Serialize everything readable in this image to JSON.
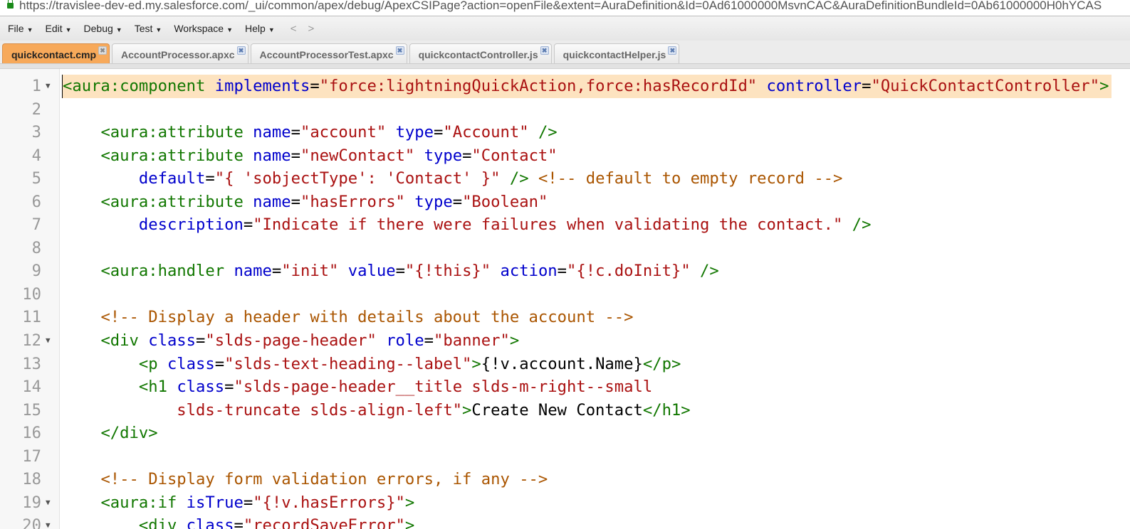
{
  "browser": {
    "url": "https://travislee-dev-ed.my.salesforce.com/_ui/common/apex/debug/ApexCSIPage?action=openFile&extent=AuraDefinition&Id=0Ad61000000MsvnCAC&AuraDefinitionBundleId=0Ab61000000H0hYCAS"
  },
  "menu": [
    {
      "label": "File"
    },
    {
      "label": "Edit"
    },
    {
      "label": "Debug"
    },
    {
      "label": "Test"
    },
    {
      "label": "Workspace"
    },
    {
      "label": "Help"
    }
  ],
  "nav": {
    "back": "<",
    "forward": ">"
  },
  "tabs": [
    {
      "label": "quickcontact.cmp",
      "active": true
    },
    {
      "label": "AccountProcessor.apxc"
    },
    {
      "label": "AccountProcessorTest.apxc"
    },
    {
      "label": "quickcontactController.js"
    },
    {
      "label": "quickcontactHelper.js"
    }
  ],
  "tab_close": "✖",
  "colors": {
    "tag": "#117700",
    "attr": "#0000cc",
    "string": "#aa1111",
    "comment": "#aa5500",
    "active_tab": "#f7a95a",
    "current_line": "#fde3c0"
  },
  "editor": {
    "lines": [
      {
        "n": "1",
        "fold": true,
        "tokens": [
          [
            "t",
            "<aura:component"
          ],
          [
            "p",
            " "
          ],
          [
            "a",
            "implements"
          ],
          [
            "p",
            "="
          ],
          [
            "s",
            "\"force:lightningQuickAction,force:hasRecordId\""
          ],
          [
            "p",
            " "
          ],
          [
            "a",
            "controller"
          ],
          [
            "p",
            "="
          ],
          [
            "s",
            "\"QuickContactController\""
          ],
          [
            "t",
            ">"
          ]
        ]
      },
      {
        "n": "2",
        "tokens": []
      },
      {
        "n": "3",
        "tokens": [
          [
            "p",
            "    "
          ],
          [
            "t",
            "<aura:attribute"
          ],
          [
            "p",
            " "
          ],
          [
            "a",
            "name"
          ],
          [
            "p",
            "="
          ],
          [
            "s",
            "\"account\""
          ],
          [
            "p",
            " "
          ],
          [
            "a",
            "type"
          ],
          [
            "p",
            "="
          ],
          [
            "s",
            "\"Account\""
          ],
          [
            "p",
            " "
          ],
          [
            "t",
            "/>"
          ]
        ]
      },
      {
        "n": "4",
        "tokens": [
          [
            "p",
            "    "
          ],
          [
            "t",
            "<aura:attribute"
          ],
          [
            "p",
            " "
          ],
          [
            "a",
            "name"
          ],
          [
            "p",
            "="
          ],
          [
            "s",
            "\"newContact\""
          ],
          [
            "p",
            " "
          ],
          [
            "a",
            "type"
          ],
          [
            "p",
            "="
          ],
          [
            "s",
            "\"Contact\""
          ]
        ]
      },
      {
        "n": "5",
        "tokens": [
          [
            "p",
            "        "
          ],
          [
            "a",
            "default"
          ],
          [
            "p",
            "="
          ],
          [
            "s",
            "\"{ 'sobjectType': 'Contact' }\""
          ],
          [
            "p",
            " "
          ],
          [
            "t",
            "/>"
          ],
          [
            "p",
            " "
          ],
          [
            "c",
            "<!-- default to empty record -->"
          ]
        ]
      },
      {
        "n": "6",
        "tokens": [
          [
            "p",
            "    "
          ],
          [
            "t",
            "<aura:attribute"
          ],
          [
            "p",
            " "
          ],
          [
            "a",
            "name"
          ],
          [
            "p",
            "="
          ],
          [
            "s",
            "\"hasErrors\""
          ],
          [
            "p",
            " "
          ],
          [
            "a",
            "type"
          ],
          [
            "p",
            "="
          ],
          [
            "s",
            "\"Boolean\""
          ]
        ]
      },
      {
        "n": "7",
        "tokens": [
          [
            "p",
            "        "
          ],
          [
            "a",
            "description"
          ],
          [
            "p",
            "="
          ],
          [
            "s",
            "\"Indicate if there were failures when validating the contact.\""
          ],
          [
            "p",
            " "
          ],
          [
            "t",
            "/>"
          ]
        ]
      },
      {
        "n": "8",
        "tokens": []
      },
      {
        "n": "9",
        "tokens": [
          [
            "p",
            "    "
          ],
          [
            "t",
            "<aura:handler"
          ],
          [
            "p",
            " "
          ],
          [
            "a",
            "name"
          ],
          [
            "p",
            "="
          ],
          [
            "s",
            "\"init\""
          ],
          [
            "p",
            " "
          ],
          [
            "a",
            "value"
          ],
          [
            "p",
            "="
          ],
          [
            "s",
            "\"{!this}\""
          ],
          [
            "p",
            " "
          ],
          [
            "a",
            "action"
          ],
          [
            "p",
            "="
          ],
          [
            "s",
            "\"{!c.doInit}\""
          ],
          [
            "p",
            " "
          ],
          [
            "t",
            "/>"
          ]
        ]
      },
      {
        "n": "10",
        "tokens": []
      },
      {
        "n": "11",
        "tokens": [
          [
            "p",
            "    "
          ],
          [
            "c",
            "<!-- Display a header with details about the account -->"
          ]
        ]
      },
      {
        "n": "12",
        "fold": true,
        "tokens": [
          [
            "p",
            "    "
          ],
          [
            "t",
            "<div"
          ],
          [
            "p",
            " "
          ],
          [
            "a",
            "class"
          ],
          [
            "p",
            "="
          ],
          [
            "s",
            "\"slds-page-header\""
          ],
          [
            "p",
            " "
          ],
          [
            "a",
            "role"
          ],
          [
            "p",
            "="
          ],
          [
            "s",
            "\"banner\""
          ],
          [
            "t",
            ">"
          ]
        ]
      },
      {
        "n": "13",
        "tokens": [
          [
            "p",
            "        "
          ],
          [
            "t",
            "<p"
          ],
          [
            "p",
            " "
          ],
          [
            "a",
            "class"
          ],
          [
            "p",
            "="
          ],
          [
            "s",
            "\"slds-text-heading--label\""
          ],
          [
            "t",
            ">"
          ],
          [
            "p",
            "{!v.account.Name}"
          ],
          [
            "t",
            "</p>"
          ]
        ]
      },
      {
        "n": "14",
        "tokens": [
          [
            "p",
            "        "
          ],
          [
            "t",
            "<h1"
          ],
          [
            "p",
            " "
          ],
          [
            "a",
            "class"
          ],
          [
            "p",
            "="
          ],
          [
            "s",
            "\"slds-page-header__title slds-m-right--small"
          ]
        ]
      },
      {
        "n": "15",
        "tokens": [
          [
            "s",
            "            slds-truncate slds-align-left\""
          ],
          [
            "t",
            ">"
          ],
          [
            "p",
            "Create New Contact"
          ],
          [
            "t",
            "</h1>"
          ]
        ]
      },
      {
        "n": "16",
        "tokens": [
          [
            "p",
            "    "
          ],
          [
            "t",
            "</div>"
          ]
        ]
      },
      {
        "n": "17",
        "tokens": []
      },
      {
        "n": "18",
        "tokens": [
          [
            "p",
            "    "
          ],
          [
            "c",
            "<!-- Display form validation errors, if any -->"
          ]
        ]
      },
      {
        "n": "19",
        "fold": true,
        "tokens": [
          [
            "p",
            "    "
          ],
          [
            "t",
            "<aura:if"
          ],
          [
            "p",
            " "
          ],
          [
            "a",
            "isTrue"
          ],
          [
            "p",
            "="
          ],
          [
            "s",
            "\"{!v.hasErrors}\""
          ],
          [
            "t",
            ">"
          ]
        ]
      },
      {
        "n": "20",
        "fold": true,
        "tokens": [
          [
            "p",
            "        "
          ],
          [
            "t",
            "<div"
          ],
          [
            "p",
            " "
          ],
          [
            "a",
            "class"
          ],
          [
            "p",
            "="
          ],
          [
            "s",
            "\"recordSaveError\""
          ],
          [
            "t",
            ">"
          ]
        ]
      }
    ]
  }
}
